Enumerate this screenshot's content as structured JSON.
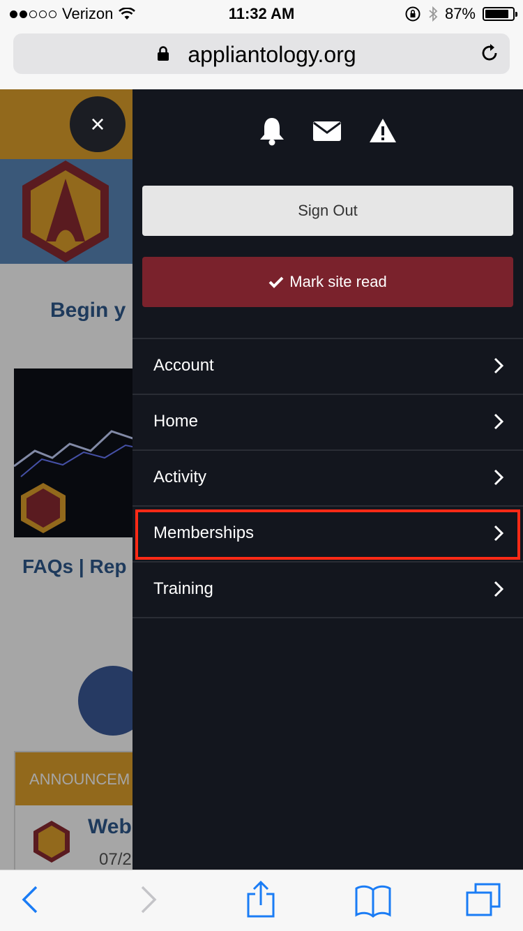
{
  "status_bar": {
    "carrier": "Verizon",
    "time": "11:32 AM",
    "battery": "87%",
    "battery_level": 0.87
  },
  "browser": {
    "url": "appliantology.org"
  },
  "page": {
    "begin_text": "Begin y",
    "faq_text": "FAQs",
    "separator": "|",
    "rep_text": "Rep",
    "announcements": "ANNOUNCEM",
    "web_text": "Web",
    "date_text": "07/2"
  },
  "drawer": {
    "close_label": "×",
    "sign_out": "Sign Out",
    "mark_site_read": "Mark site read",
    "menu": [
      {
        "label": "Account"
      },
      {
        "label": "Home"
      },
      {
        "label": "Activity"
      },
      {
        "label": "Memberships"
      },
      {
        "label": "Training"
      }
    ]
  },
  "colors": {
    "drawer_bg": "#13161e",
    "mark_read_bg": "#7a222c",
    "highlight": "#ff2a16",
    "ios_blue": "#1a7cf5",
    "brand_gold": "#e0a12c"
  }
}
